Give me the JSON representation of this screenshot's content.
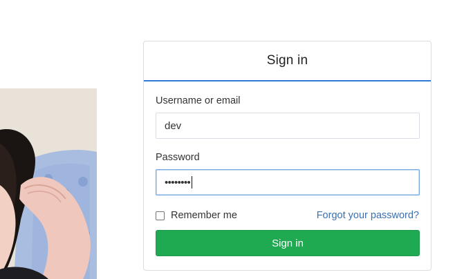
{
  "login": {
    "title": "Sign in",
    "username_label": "Username or email",
    "username_value": "dev",
    "password_label": "Password",
    "password_masked": "••••••••",
    "remember_label": "Remember me",
    "remember_checked": false,
    "forgot_label": "Forgot your password?",
    "submit_label": "Sign in"
  },
  "colors": {
    "accent_blue": "#2b7bd6",
    "link_blue": "#3a6fb0",
    "submit_green": "#1faa52"
  }
}
